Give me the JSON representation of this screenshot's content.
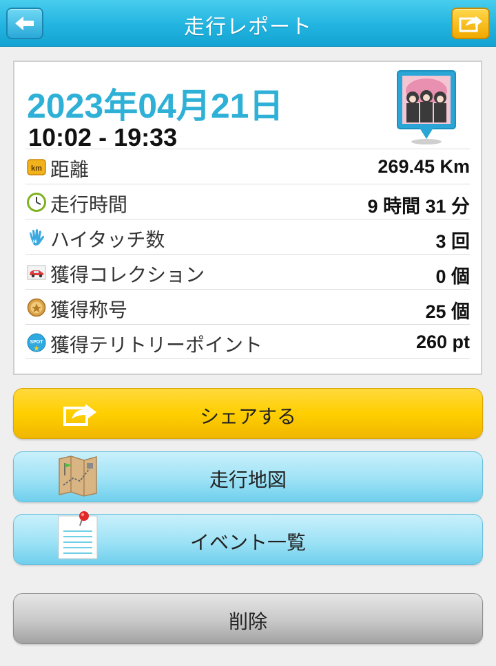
{
  "header": {
    "title": "走行レポート",
    "back_icon": "arrow-left-icon",
    "share_icon": "share-arrow-icon"
  },
  "report": {
    "date": "2023年04月21日",
    "time_range": "10:02 - 19:33",
    "avatar_icon": "avatar-map-pin-icon"
  },
  "stats": [
    {
      "icon": "km-icon",
      "label": "距離",
      "value": "269.45 Km"
    },
    {
      "icon": "clock-icon",
      "label": "走行時間",
      "value": "9 時間 31 分"
    },
    {
      "icon": "hand-icon",
      "label": "ハイタッチ数",
      "value": "3 回"
    },
    {
      "icon": "car-icon",
      "label": "獲得コレクション",
      "value": "0 個"
    },
    {
      "icon": "medal-icon",
      "label": "獲得称号",
      "value": "25 個"
    },
    {
      "icon": "spot-icon",
      "label": "獲得テリトリーポイント",
      "value": "260 pt"
    }
  ],
  "buttons": {
    "share": "シェアする",
    "map": "走行地図",
    "events": "イベント一覧",
    "delete": "削除"
  },
  "colors": {
    "header": "#22b4e0",
    "date_text": "#2fb0d6",
    "share_button": "#ffcf00",
    "blue_button": "#9ee2f6",
    "delete_button": "#c8c8c8"
  }
}
